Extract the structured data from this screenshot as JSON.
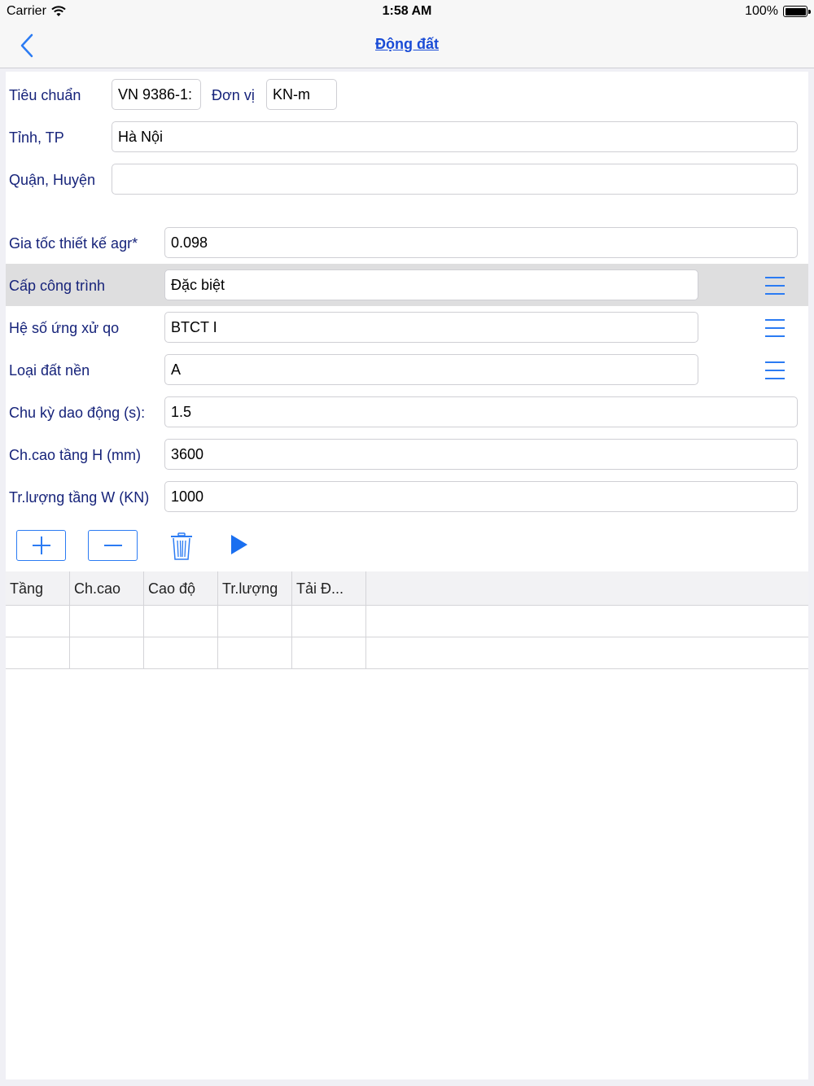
{
  "status_bar": {
    "carrier": "Carrier",
    "time": "1:58 AM",
    "battery": "100%"
  },
  "nav": {
    "title": "Động đất",
    "back_icon": "chevron-left-icon"
  },
  "form": {
    "standard_label": "Tiêu chuẩn",
    "standard_value": "VN 9386-1:",
    "unit_label": "Đơn vị",
    "unit_value": "KN-m",
    "province_label": "Tỉnh, TP",
    "province_value": "Hà Nội",
    "district_label": "Quận, Huyện",
    "district_value": "",
    "accel_label": "Gia tốc thiết kế agr*",
    "accel_value": "0.098",
    "class_label": "Cấp công trình",
    "class_value": "Đặc biệt",
    "behavior_label": "Hệ số ứng xử qo",
    "behavior_value": "BTCT I",
    "soil_label": "Loại đất nền",
    "soil_value": "A",
    "period_label": "Chu kỳ dao động (s):",
    "period_value": "1.5",
    "height_label": "Ch.cao tầng H (mm)",
    "height_value": "3600",
    "weight_label": "Tr.lượng tầng W (KN)",
    "weight_value": "1000"
  },
  "toolbar": {
    "add_icon": "plus-icon",
    "remove_icon": "minus-icon",
    "delete_icon": "trash-icon",
    "run_icon": "play-icon",
    "accent": "#2b7bf3"
  },
  "table": {
    "columns": [
      "Tầng",
      "Ch.cao",
      "Cao độ",
      "Tr.lượng",
      "Tải Đ..."
    ]
  }
}
